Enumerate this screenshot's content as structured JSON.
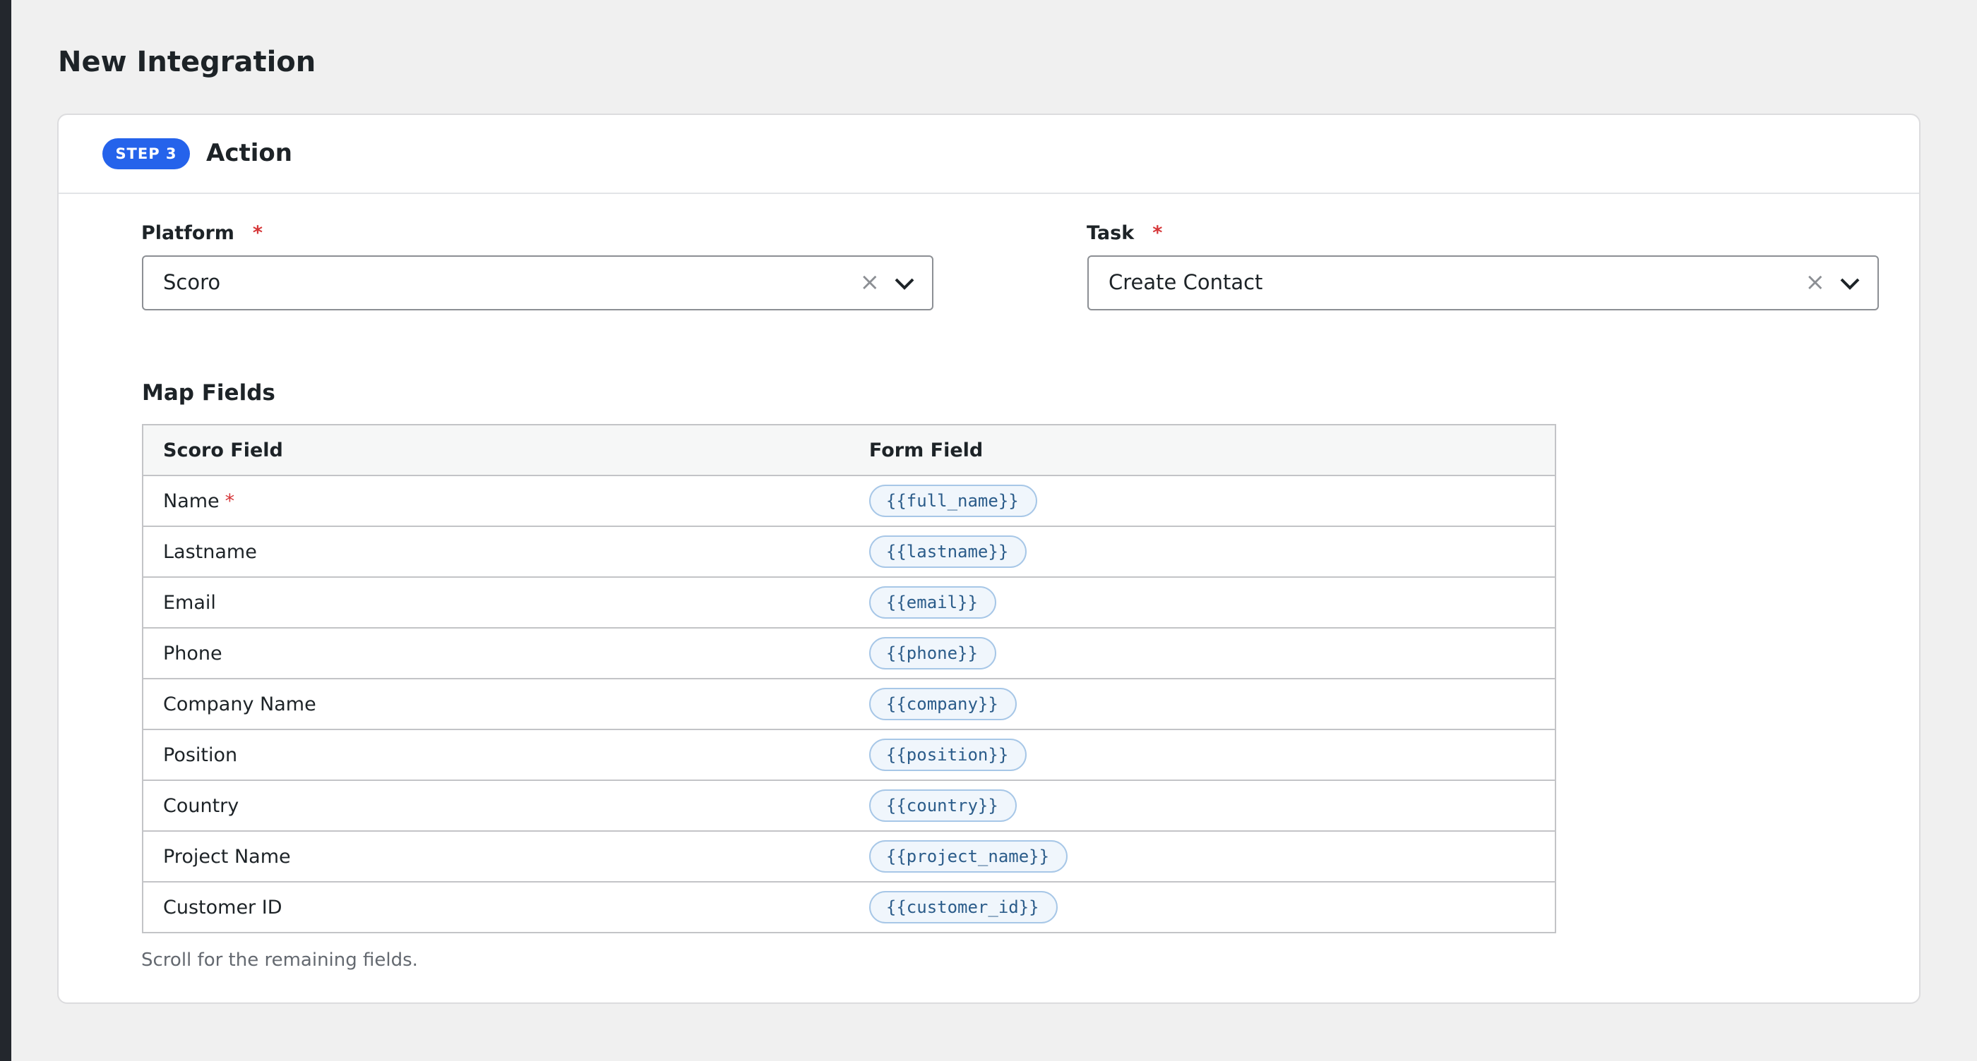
{
  "page": {
    "title": "New Integration"
  },
  "step": {
    "badge": "STEP 3",
    "title": "Action"
  },
  "platform": {
    "label": "Platform",
    "required_mark": "*",
    "value": "Scoro"
  },
  "task": {
    "label": "Task",
    "required_mark": "*",
    "value": "Create Contact"
  },
  "map_fields": {
    "title": "Map Fields",
    "columns": [
      "Scoro Field",
      "Form Field"
    ],
    "rows": [
      {
        "field": "Name",
        "required": "*",
        "token": "{{full_name}}"
      },
      {
        "field": "Lastname",
        "required": "",
        "token": "{{lastname}}"
      },
      {
        "field": "Email",
        "required": "",
        "token": "{{email}}"
      },
      {
        "field": "Phone",
        "required": "",
        "token": "{{phone}}"
      },
      {
        "field": "Company Name",
        "required": "",
        "token": "{{company}}"
      },
      {
        "field": "Position",
        "required": "",
        "token": "{{position}}"
      },
      {
        "field": "Country",
        "required": "",
        "token": "{{country}}"
      },
      {
        "field": "Project Name",
        "required": "",
        "token": "{{project_name}}"
      },
      {
        "field": "Customer ID",
        "required": "",
        "token": "{{customer_id}}"
      }
    ],
    "hint": "Scroll for the remaining fields."
  },
  "icons": {
    "clear": "close-icon",
    "dropdown": "chevron-down-icon"
  },
  "colors": {
    "accent": "#2563eb",
    "required": "#d63638",
    "token_text": "#2b5c8a"
  }
}
